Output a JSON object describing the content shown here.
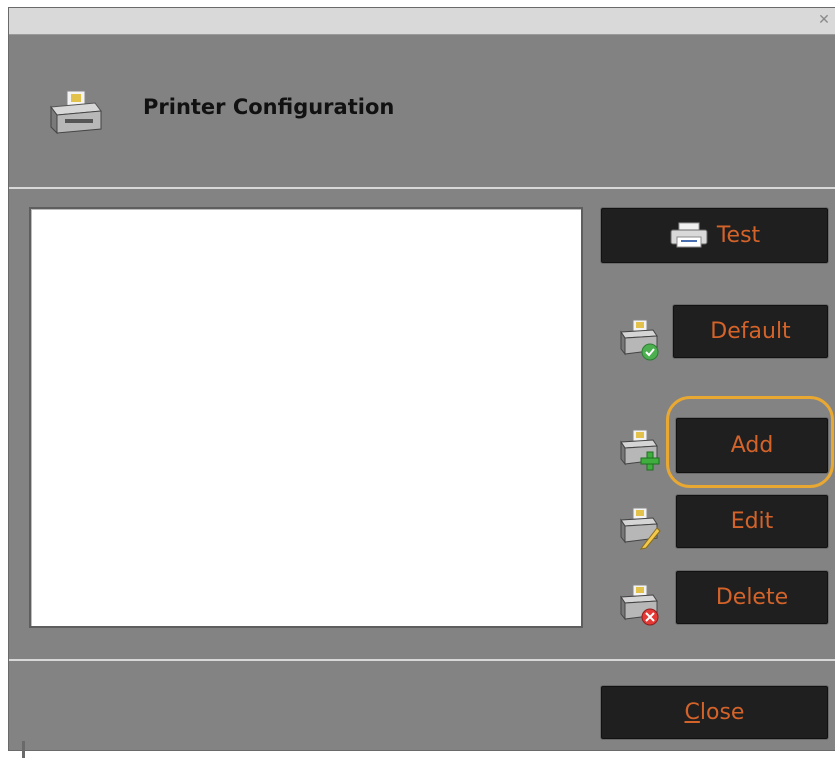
{
  "window": {
    "title_bar_close_glyph": "✕"
  },
  "header": {
    "title": "Printer Configuration",
    "icon": "printer-icon"
  },
  "printer_list": {
    "items": []
  },
  "buttons": {
    "test": {
      "label": "Test",
      "icon": "printer-icon"
    },
    "default": {
      "label": "Default",
      "icon": "printer-default-icon"
    },
    "add": {
      "label": "Add",
      "icon": "printer-add-icon"
    },
    "edit": {
      "label": "Edit",
      "icon": "printer-edit-icon"
    },
    "delete": {
      "label": "Delete",
      "icon": "printer-delete-icon"
    },
    "close": {
      "label_first": "C",
      "label_rest": "lose"
    }
  },
  "colors": {
    "accent_text": "#d4632a",
    "highlight": "#e8a832",
    "panel": "#838383",
    "button_bg": "#1f1f1f"
  }
}
